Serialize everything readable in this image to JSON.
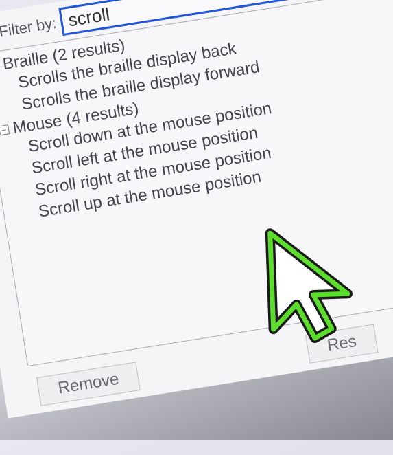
{
  "filter": {
    "label": "Filter by:",
    "value": "scroll"
  },
  "leftFragment": "img",
  "groups": [
    {
      "header": "Braille (2 results)",
      "expander": "−",
      "items": [
        "Scrolls the braille display back",
        "Scrolls the braille display forward"
      ]
    },
    {
      "header": "Mouse (4 results)",
      "expander": "−",
      "items": [
        "Scroll down at the mouse position",
        "Scroll left at the mouse position",
        "Scroll right at the mouse position",
        "Scroll up at the mouse position"
      ]
    }
  ],
  "buttons": {
    "remove": "Remove",
    "reset": "Res"
  }
}
